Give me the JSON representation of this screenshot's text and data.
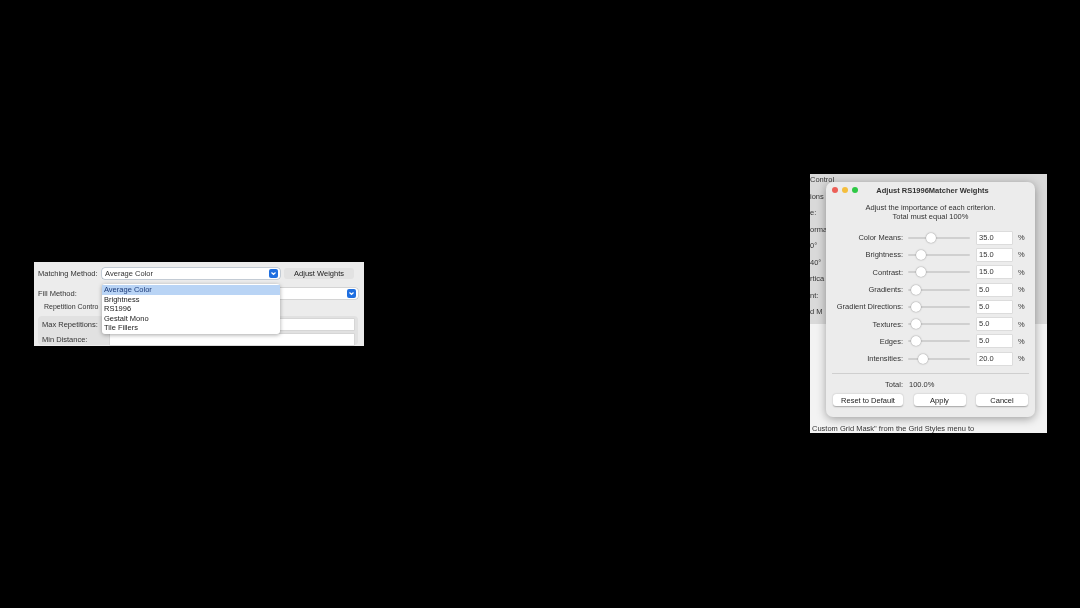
{
  "left_panel": {
    "matching_method": {
      "label": "Matching Method:",
      "value": "Average Color",
      "expanded": true
    },
    "adjust_button": "Adjust Weights",
    "fill_method": {
      "label": "Fill Method:"
    },
    "repetition_tab": "Repetition Contro",
    "fields": [
      {
        "label": "Max Repetitions:"
      },
      {
        "label": "Min Distance:"
      }
    ],
    "dropdown": [
      {
        "label": "Average Color",
        "selected": true
      },
      {
        "label": "Brightness",
        "selected": false
      },
      {
        "label": "RS1996",
        "selected": false
      },
      {
        "label": "Gestalt Mono",
        "selected": false
      },
      {
        "label": "Tile Fillers",
        "selected": false
      }
    ]
  },
  "background_window": {
    "fragments": [
      "Control",
      "ions",
      "e:",
      "orma",
      "0°",
      "40°",
      "rtica",
      "nt:",
      "d M"
    ],
    "footer": "Custom Grid Mask\" from the Grid Styles menu to"
  },
  "dialog": {
    "title": "Adjust RS1996Matcher Weights",
    "description": [
      "Adjust the importance of each criterion.",
      "Total must equal 100%"
    ],
    "weights": [
      {
        "name": "Color Means:",
        "level": 0.35,
        "value": "35.0",
        "unit": "%"
      },
      {
        "name": "Brightness:",
        "level": 0.15,
        "value": "15.0",
        "unit": "%"
      },
      {
        "name": "Contrast:",
        "level": 0.15,
        "value": "15.0",
        "unit": "%"
      },
      {
        "name": "Gradients:",
        "level": 0.05,
        "value": "5.0",
        "unit": "%"
      },
      {
        "name": "Gradient Directions:",
        "level": 0.05,
        "value": "5.0",
        "unit": "%"
      },
      {
        "name": "Textures:",
        "level": 0.05,
        "value": "5.0",
        "unit": "%"
      },
      {
        "name": "Edges:",
        "level": 0.05,
        "value": "5.0",
        "unit": "%"
      },
      {
        "name": "Intensities:",
        "level": 0.2,
        "value": "20.0",
        "unit": "%"
      }
    ],
    "total_label": "Total:",
    "total_value": "100.0%",
    "buttons": [
      "Reset to Default",
      "Apply",
      "Cancel"
    ]
  }
}
